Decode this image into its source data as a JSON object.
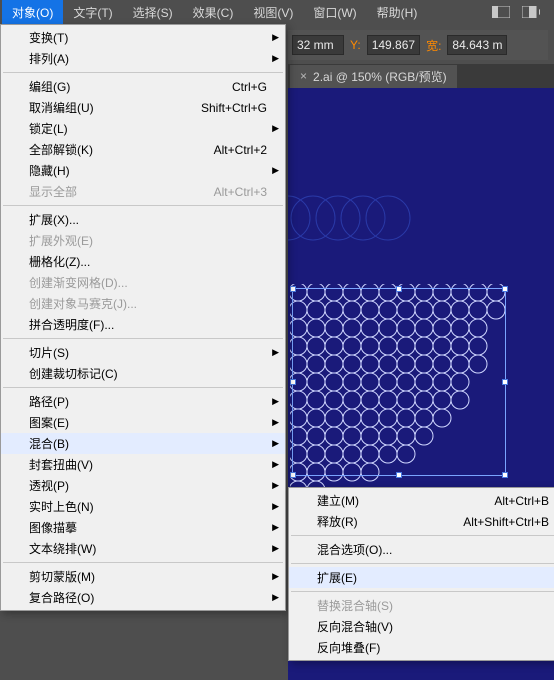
{
  "menubar": {
    "items": [
      "对象(O)",
      "文字(T)",
      "选择(S)",
      "效果(C)",
      "视图(V)",
      "窗口(W)",
      "帮助(H)"
    ]
  },
  "controlbar": {
    "val1": "32 mm",
    "y_label": "Y:",
    "y_val": "149.867",
    "w_label": "宽:",
    "w_val": "84.643 m"
  },
  "tab": {
    "close": "×",
    "label": "2.ai @ 150% (RGB/预览)"
  },
  "mainmenu": [
    {
      "type": "item",
      "label": "变换(T)",
      "arrow": true
    },
    {
      "type": "item",
      "label": "排列(A)",
      "arrow": true
    },
    {
      "type": "sep"
    },
    {
      "type": "item",
      "label": "编组(G)",
      "shortcut": "Ctrl+G"
    },
    {
      "type": "item",
      "label": "取消编组(U)",
      "shortcut": "Shift+Ctrl+G"
    },
    {
      "type": "item",
      "label": "锁定(L)",
      "arrow": true
    },
    {
      "type": "item",
      "label": "全部解锁(K)",
      "shortcut": "Alt+Ctrl+2"
    },
    {
      "type": "item",
      "label": "隐藏(H)",
      "arrow": true
    },
    {
      "type": "item",
      "label": "显示全部",
      "shortcut": "Alt+Ctrl+3",
      "disabled": true
    },
    {
      "type": "sep"
    },
    {
      "type": "item",
      "label": "扩展(X)..."
    },
    {
      "type": "item",
      "label": "扩展外观(E)",
      "disabled": true
    },
    {
      "type": "item",
      "label": "栅格化(Z)..."
    },
    {
      "type": "item",
      "label": "创建渐变网格(D)...",
      "disabled": true
    },
    {
      "type": "item",
      "label": "创建对象马赛克(J)...",
      "disabled": true
    },
    {
      "type": "item",
      "label": "拼合透明度(F)..."
    },
    {
      "type": "sep"
    },
    {
      "type": "item",
      "label": "切片(S)",
      "arrow": true
    },
    {
      "type": "item",
      "label": "创建裁切标记(C)"
    },
    {
      "type": "sep"
    },
    {
      "type": "item",
      "label": "路径(P)",
      "arrow": true
    },
    {
      "type": "item",
      "label": "图案(E)",
      "arrow": true
    },
    {
      "type": "item",
      "label": "混合(B)",
      "arrow": true,
      "highlight": true
    },
    {
      "type": "item",
      "label": "封套扭曲(V)",
      "arrow": true
    },
    {
      "type": "item",
      "label": "透视(P)",
      "arrow": true
    },
    {
      "type": "item",
      "label": "实时上色(N)",
      "arrow": true
    },
    {
      "type": "item",
      "label": "图像描摹",
      "arrow": true
    },
    {
      "type": "item",
      "label": "文本绕排(W)",
      "arrow": true
    },
    {
      "type": "sep"
    },
    {
      "type": "item",
      "label": "剪切蒙版(M)",
      "arrow": true
    },
    {
      "type": "item",
      "label": "复合路径(O)",
      "arrow": true
    }
  ],
  "submenu": [
    {
      "type": "item",
      "label": "建立(M)",
      "shortcut": "Alt+Ctrl+B"
    },
    {
      "type": "item",
      "label": "释放(R)",
      "shortcut": "Alt+Shift+Ctrl+B"
    },
    {
      "type": "sep"
    },
    {
      "type": "item",
      "label": "混合选项(O)..."
    },
    {
      "type": "sep"
    },
    {
      "type": "item",
      "label": "扩展(E)",
      "highlight": true
    },
    {
      "type": "sep"
    },
    {
      "type": "item",
      "label": "替换混合轴(S)",
      "disabled": true
    },
    {
      "type": "item",
      "label": "反向混合轴(V)"
    },
    {
      "type": "item",
      "label": "反向堆叠(F)"
    }
  ]
}
